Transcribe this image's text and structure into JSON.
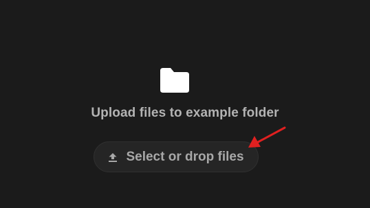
{
  "upload": {
    "title": "Upload files to example folder",
    "button_label": "Select or drop files"
  },
  "icons": {
    "folder": "folder-icon",
    "upload": "upload-icon"
  },
  "colors": {
    "background": "#1b1b1b",
    "button_background": "#252525",
    "text": "#b3b3b3",
    "folder": "#ffffff",
    "annotation_arrow": "#e02020"
  }
}
